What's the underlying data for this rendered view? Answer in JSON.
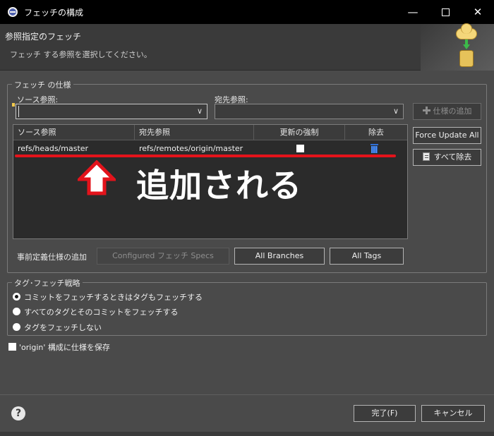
{
  "window": {
    "title": "フェッチの構成",
    "minimize_glyph": "—",
    "close_glyph": "✕"
  },
  "header": {
    "title": "参照指定のフェッチ",
    "description": "フェッチ する参照を選択してください。"
  },
  "spec_group": {
    "legend": "フェッチ の仕様",
    "source_label": "ソース参照:",
    "destination_label": "宛先参照:",
    "source_value": "",
    "destination_value": "",
    "add_spec_button": "仕様の追加",
    "force_update_all_button": "Force Update All",
    "remove_all_button": "すべて除去",
    "table": {
      "columns": [
        "ソース参照",
        "宛先参照",
        "更新の強制",
        "除去"
      ],
      "rows": [
        {
          "source": "refs/heads/master",
          "destination": "refs/remotes/origin/master",
          "force_update": false
        }
      ]
    },
    "predefined_label": "事前定義仕様の追加",
    "configured_specs_button": "Configured フェッチ Specs",
    "all_branches_button": "All Branches",
    "all_tags_button": "All Tags"
  },
  "annotation": {
    "text": "追加される",
    "color": "#e3131b"
  },
  "tag_group": {
    "legend": "タグ･フェッチ戦略",
    "options": [
      {
        "label": "コミットをフェッチするときはタグもフェッチする",
        "selected": true
      },
      {
        "label": "すべてのタグとそのコミットをフェッチする",
        "selected": false
      },
      {
        "label": "タグをフェッチしない",
        "selected": false
      }
    ]
  },
  "save_config": {
    "label": "'origin' 構成に仕様を保存",
    "checked": false
  },
  "footer": {
    "help_glyph": "?",
    "finish_button": "完了(F)",
    "cancel_button": "キャンセル"
  }
}
